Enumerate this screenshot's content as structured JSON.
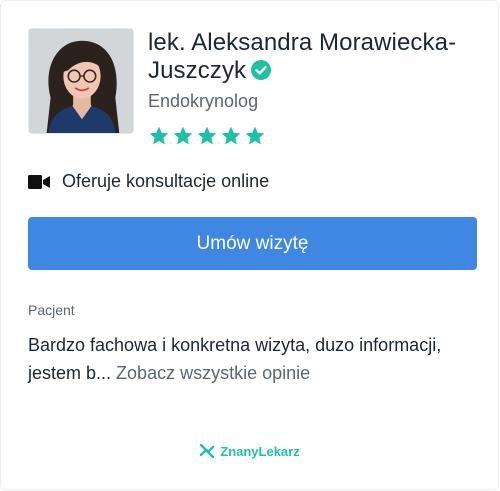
{
  "doctor": {
    "name_line1": "lek. Aleksandra Morawiecka-",
    "name_line2": "Juszczyk",
    "specialty": "Endokrynolog",
    "rating": 5,
    "rating_max": 5,
    "verified": true
  },
  "online": {
    "label": "Oferuje konsultacje online"
  },
  "actions": {
    "book_label": "Umów wizytę"
  },
  "review": {
    "author": "Pacjent",
    "text": "Bardzo fachowa i konkretna wizyta, duzo informacji, jestem b...",
    "see_all_label": "Zobacz wszystkie opinie"
  },
  "brand": {
    "name": "ZnanyLekarz"
  },
  "colors": {
    "accent_green": "#1ec2a3",
    "button_blue": "#3f87e0",
    "text_dark": "#1b2733",
    "text_muted": "#5b6673"
  },
  "icons": {
    "verified": "check-circle-icon",
    "star": "star-icon",
    "video": "video-camera-icon",
    "brand": "znanylekarz-logo-icon"
  }
}
